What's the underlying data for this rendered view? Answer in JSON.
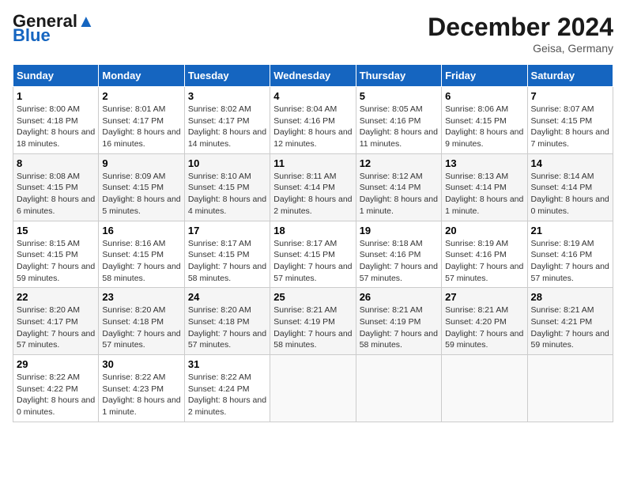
{
  "header": {
    "logo_line1": "General",
    "logo_line2": "Blue",
    "month": "December 2024",
    "location": "Geisa, Germany"
  },
  "weekdays": [
    "Sunday",
    "Monday",
    "Tuesday",
    "Wednesday",
    "Thursday",
    "Friday",
    "Saturday"
  ],
  "weeks": [
    [
      {
        "day": "1",
        "sunrise": "Sunrise: 8:00 AM",
        "sunset": "Sunset: 4:18 PM",
        "daylight": "Daylight: 8 hours and 18 minutes."
      },
      {
        "day": "2",
        "sunrise": "Sunrise: 8:01 AM",
        "sunset": "Sunset: 4:17 PM",
        "daylight": "Daylight: 8 hours and 16 minutes."
      },
      {
        "day": "3",
        "sunrise": "Sunrise: 8:02 AM",
        "sunset": "Sunset: 4:17 PM",
        "daylight": "Daylight: 8 hours and 14 minutes."
      },
      {
        "day": "4",
        "sunrise": "Sunrise: 8:04 AM",
        "sunset": "Sunset: 4:16 PM",
        "daylight": "Daylight: 8 hours and 12 minutes."
      },
      {
        "day": "5",
        "sunrise": "Sunrise: 8:05 AM",
        "sunset": "Sunset: 4:16 PM",
        "daylight": "Daylight: 8 hours and 11 minutes."
      },
      {
        "day": "6",
        "sunrise": "Sunrise: 8:06 AM",
        "sunset": "Sunset: 4:15 PM",
        "daylight": "Daylight: 8 hours and 9 minutes."
      },
      {
        "day": "7",
        "sunrise": "Sunrise: 8:07 AM",
        "sunset": "Sunset: 4:15 PM",
        "daylight": "Daylight: 8 hours and 7 minutes."
      }
    ],
    [
      {
        "day": "8",
        "sunrise": "Sunrise: 8:08 AM",
        "sunset": "Sunset: 4:15 PM",
        "daylight": "Daylight: 8 hours and 6 minutes."
      },
      {
        "day": "9",
        "sunrise": "Sunrise: 8:09 AM",
        "sunset": "Sunset: 4:15 PM",
        "daylight": "Daylight: 8 hours and 5 minutes."
      },
      {
        "day": "10",
        "sunrise": "Sunrise: 8:10 AM",
        "sunset": "Sunset: 4:15 PM",
        "daylight": "Daylight: 8 hours and 4 minutes."
      },
      {
        "day": "11",
        "sunrise": "Sunrise: 8:11 AM",
        "sunset": "Sunset: 4:14 PM",
        "daylight": "Daylight: 8 hours and 2 minutes."
      },
      {
        "day": "12",
        "sunrise": "Sunrise: 8:12 AM",
        "sunset": "Sunset: 4:14 PM",
        "daylight": "Daylight: 8 hours and 1 minute."
      },
      {
        "day": "13",
        "sunrise": "Sunrise: 8:13 AM",
        "sunset": "Sunset: 4:14 PM",
        "daylight": "Daylight: 8 hours and 1 minute."
      },
      {
        "day": "14",
        "sunrise": "Sunrise: 8:14 AM",
        "sunset": "Sunset: 4:14 PM",
        "daylight": "Daylight: 8 hours and 0 minutes."
      }
    ],
    [
      {
        "day": "15",
        "sunrise": "Sunrise: 8:15 AM",
        "sunset": "Sunset: 4:15 PM",
        "daylight": "Daylight: 7 hours and 59 minutes."
      },
      {
        "day": "16",
        "sunrise": "Sunrise: 8:16 AM",
        "sunset": "Sunset: 4:15 PM",
        "daylight": "Daylight: 7 hours and 58 minutes."
      },
      {
        "day": "17",
        "sunrise": "Sunrise: 8:17 AM",
        "sunset": "Sunset: 4:15 PM",
        "daylight": "Daylight: 7 hours and 58 minutes."
      },
      {
        "day": "18",
        "sunrise": "Sunrise: 8:17 AM",
        "sunset": "Sunset: 4:15 PM",
        "daylight": "Daylight: 7 hours and 57 minutes."
      },
      {
        "day": "19",
        "sunrise": "Sunrise: 8:18 AM",
        "sunset": "Sunset: 4:16 PM",
        "daylight": "Daylight: 7 hours and 57 minutes."
      },
      {
        "day": "20",
        "sunrise": "Sunrise: 8:19 AM",
        "sunset": "Sunset: 4:16 PM",
        "daylight": "Daylight: 7 hours and 57 minutes."
      },
      {
        "day": "21",
        "sunrise": "Sunrise: 8:19 AM",
        "sunset": "Sunset: 4:16 PM",
        "daylight": "Daylight: 7 hours and 57 minutes."
      }
    ],
    [
      {
        "day": "22",
        "sunrise": "Sunrise: 8:20 AM",
        "sunset": "Sunset: 4:17 PM",
        "daylight": "Daylight: 7 hours and 57 minutes."
      },
      {
        "day": "23",
        "sunrise": "Sunrise: 8:20 AM",
        "sunset": "Sunset: 4:18 PM",
        "daylight": "Daylight: 7 hours and 57 minutes."
      },
      {
        "day": "24",
        "sunrise": "Sunrise: 8:20 AM",
        "sunset": "Sunset: 4:18 PM",
        "daylight": "Daylight: 7 hours and 57 minutes."
      },
      {
        "day": "25",
        "sunrise": "Sunrise: 8:21 AM",
        "sunset": "Sunset: 4:19 PM",
        "daylight": "Daylight: 7 hours and 58 minutes."
      },
      {
        "day": "26",
        "sunrise": "Sunrise: 8:21 AM",
        "sunset": "Sunset: 4:19 PM",
        "daylight": "Daylight: 7 hours and 58 minutes."
      },
      {
        "day": "27",
        "sunrise": "Sunrise: 8:21 AM",
        "sunset": "Sunset: 4:20 PM",
        "daylight": "Daylight: 7 hours and 59 minutes."
      },
      {
        "day": "28",
        "sunrise": "Sunrise: 8:21 AM",
        "sunset": "Sunset: 4:21 PM",
        "daylight": "Daylight: 7 hours and 59 minutes."
      }
    ],
    [
      {
        "day": "29",
        "sunrise": "Sunrise: 8:22 AM",
        "sunset": "Sunset: 4:22 PM",
        "daylight": "Daylight: 8 hours and 0 minutes."
      },
      {
        "day": "30",
        "sunrise": "Sunrise: 8:22 AM",
        "sunset": "Sunset: 4:23 PM",
        "daylight": "Daylight: 8 hours and 1 minute."
      },
      {
        "day": "31",
        "sunrise": "Sunrise: 8:22 AM",
        "sunset": "Sunset: 4:24 PM",
        "daylight": "Daylight: 8 hours and 2 minutes."
      },
      null,
      null,
      null,
      null
    ]
  ]
}
